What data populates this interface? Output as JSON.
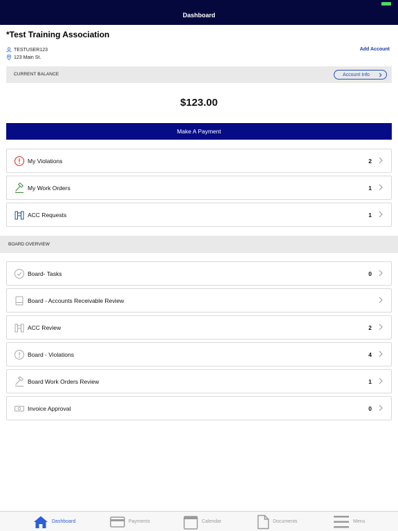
{
  "header": {
    "title": "Dashboard"
  },
  "account": {
    "name": "*Test Training Association",
    "username": "TESTUSER123",
    "address": "123 Main St.",
    "add_account_label": "Add Account"
  },
  "balance": {
    "label": "CURRENT BALANCE",
    "account_info_label": "Account Info",
    "amount": "$123.00"
  },
  "payment_button_label": "Make A Payment",
  "my_items": [
    {
      "label": "My Violations",
      "count": "2",
      "icon": "alert-circle-icon"
    },
    {
      "label": "My Work Orders",
      "count": "1",
      "icon": "hammer-icon"
    },
    {
      "label": "ACC Requests",
      "count": "1",
      "icon": "building-icon"
    }
  ],
  "board_section_label": "BOARD OVERVIEW",
  "board_items": [
    {
      "label": "Board- Tasks",
      "count": "0",
      "icon": "check-circle-icon"
    },
    {
      "label": "Board - Accounts Receivable Review",
      "count": "",
      "icon": "ledger-icon"
    },
    {
      "label": "ACC Review",
      "count": "2",
      "icon": "building-icon"
    },
    {
      "label": "Board - Violations",
      "count": "4",
      "icon": "alert-circle-icon"
    },
    {
      "label": "Board Work Orders Review",
      "count": "1",
      "icon": "hammer-icon"
    },
    {
      "label": "Invoice Approval",
      "count": "0",
      "icon": "cash-icon"
    }
  ],
  "tabs": [
    {
      "label": "Dashboard",
      "icon": "home-icon",
      "active": true
    },
    {
      "label": "Payments",
      "icon": "credit-card-icon",
      "active": false
    },
    {
      "label": "Calendar",
      "icon": "calendar-icon",
      "active": false
    },
    {
      "label": "Documents",
      "icon": "document-icon",
      "active": false
    },
    {
      "label": "Menu",
      "icon": "menu-icon",
      "active": false
    }
  ],
  "colors": {
    "header_bg": "#05083c",
    "pay_button_bg": "#060b86",
    "link_blue": "#1a3ea3",
    "active_tab": "#2c5fd6",
    "violation_red": "#d9342b",
    "acc_blue": "#1f4f8f",
    "work_order_green": "#3b8a3a"
  }
}
